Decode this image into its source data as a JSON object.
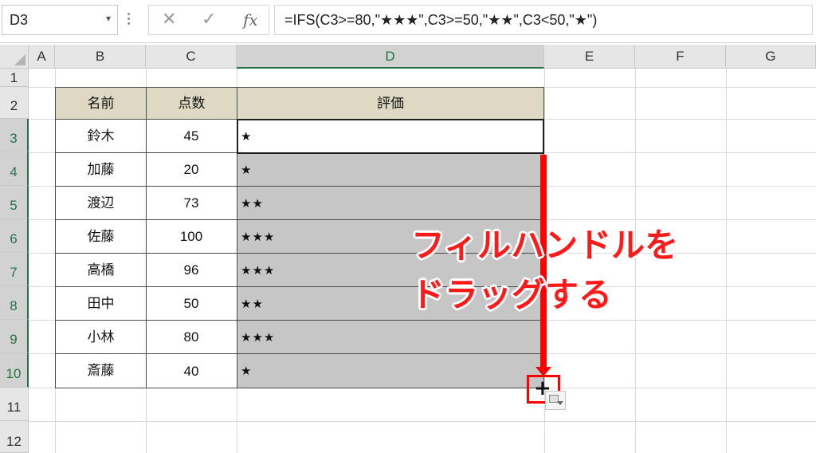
{
  "formula_bar": {
    "name_box": "D3",
    "name_box_arrow": "▾",
    "cancel_icon": "✕",
    "enter_icon": "✓",
    "fx_label": "fx",
    "formula": "=IFS(C3>=80,\"★★★\",C3>=50,\"★★\",C3<50,\"★\")"
  },
  "columns": [
    "A",
    "B",
    "C",
    "D",
    "E",
    "F",
    "G"
  ],
  "rows": [
    "1",
    "2",
    "3",
    "4",
    "5",
    "6",
    "7",
    "8",
    "9",
    "10",
    "11",
    "12"
  ],
  "table": {
    "headers": [
      "名前",
      "点数",
      "評価"
    ],
    "records": [
      {
        "name": "鈴木",
        "score": "45",
        "rating": "★"
      },
      {
        "name": "加藤",
        "score": "20",
        "rating": "★"
      },
      {
        "name": "渡辺",
        "score": "73",
        "rating": "★★"
      },
      {
        "name": "佐藤",
        "score": "100",
        "rating": "★★★"
      },
      {
        "name": "高橋",
        "score": "96",
        "rating": "★★★"
      },
      {
        "name": "田中",
        "score": "50",
        "rating": "★★"
      },
      {
        "name": "小林",
        "score": "80",
        "rating": "★★★"
      },
      {
        "name": "斎藤",
        "score": "40",
        "rating": "★"
      }
    ]
  },
  "annotation": {
    "line1": "フィルハンドルを",
    "line2": "ドラッグする"
  },
  "colors": {
    "header_fill": "#ddd9c3",
    "selection_fill": "#c6c6c6",
    "annotation": "#ff0000",
    "selected_header_accent": "#217346"
  },
  "fill_handle_icon": "+"
}
